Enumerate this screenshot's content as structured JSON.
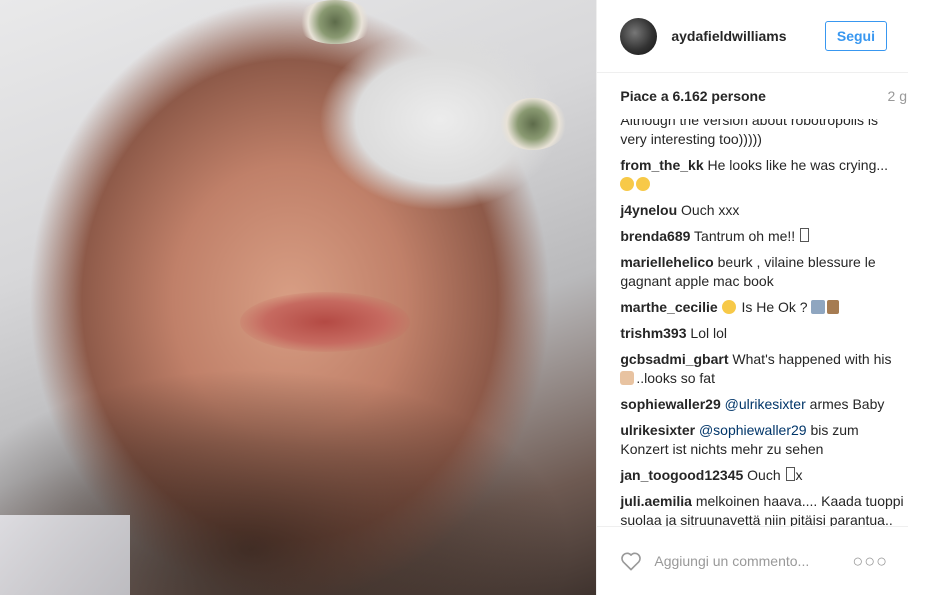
{
  "header": {
    "username": "aydafieldwilliams",
    "follow_label": "Segui"
  },
  "likes": {
    "text": "Piace a 6.162 persone",
    "time": "2 g"
  },
  "comments": [
    {
      "user": "",
      "text": "Although the version about robotropolis is very interesting too)))))"
    },
    {
      "user": "from_the_kk",
      "text": "He looks like he was crying..."
    },
    {
      "user": "j4ynelou",
      "text": "Ouch xxx"
    },
    {
      "user": "brenda689",
      "text": "Tantrum oh me!!"
    },
    {
      "user": "mariellehelico",
      "text": "beurk , vilaine blessure le gagnant apple mac book"
    },
    {
      "user": "marthe_cecilie",
      "text": "Is He Ok ?"
    },
    {
      "user": "trishm393",
      "text": "Lol lol"
    },
    {
      "user": "gcbsadmi_gbart",
      "text": "What's happened with his",
      "text2": "..looks so fat"
    },
    {
      "user": "sophiewaller29",
      "mention": "@ulrikesixter",
      "text": "armes Baby"
    },
    {
      "user": "ulrikesixter",
      "mention": "@sophiewaller29",
      "text": "bis zum Konzert ist nichts mehr zu sehen"
    },
    {
      "user": "jan_toogood12345",
      "text": "Ouch",
      "text2": "x"
    },
    {
      "user": "juli.aemilia",
      "text": "melkoinen haava.... Kaada tuoppi suolaa ja sitruunavettä niin pitäisi parantua.. varo ettei kaasunaamari pala"
    }
  ],
  "footer": {
    "placeholder": "Aggiungi un commento...",
    "more": "○○○"
  },
  "icons": {
    "heart": "heart-icon",
    "more": "more-dots-icon"
  }
}
